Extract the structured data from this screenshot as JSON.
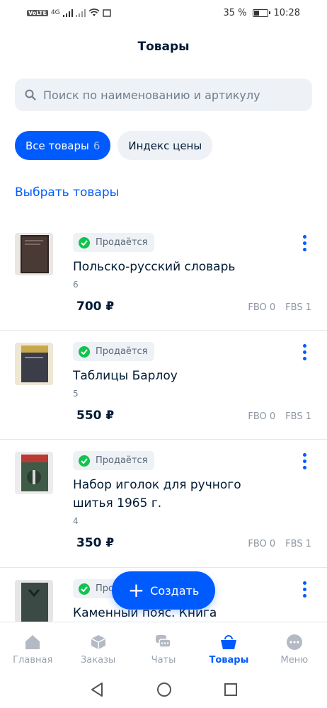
{
  "status_bar": {
    "left_icons": [
      "volte-icon",
      "signal-icon",
      "signal-icon",
      "wifi-icon",
      "notification-icon"
    ],
    "network_label": "4G",
    "battery_percent": "35 %",
    "battery_level": 0.35,
    "time": "10:28"
  },
  "header": {
    "title": "Товары"
  },
  "search": {
    "placeholder": "Поиск по наименованию и артикулу",
    "icon": "search-icon"
  },
  "filters": {
    "all_label": "Все товары",
    "all_count": "6",
    "price_index_label": "Индекс цены"
  },
  "select_link": "Выбрать товары",
  "products": [
    {
      "status": "Продаётся",
      "name": "Польско-русский словарь",
      "sku": "6",
      "price": "700 ₽",
      "fbo": "FBO 0",
      "fbs": "FBS 1"
    },
    {
      "status": "Продаётся",
      "name": "Таблицы Барлоу",
      "sku": "5",
      "price": "550 ₽",
      "fbo": "FBO 0",
      "fbs": "FBS 1"
    },
    {
      "status": "Продаётся",
      "name": "Набор иголок для ручного шитья 1965 г.",
      "sku": "4",
      "price": "350 ₽",
      "fbo": "FBO 0",
      "fbs": "FBS 1"
    },
    {
      "status": "Продаётся",
      "name": "Каменный пояс. Книга",
      "sku": "",
      "price": "",
      "fbo": "",
      "fbs": ""
    }
  ],
  "fab": {
    "label": "Создать",
    "icon": "plus-icon"
  },
  "tabbar": [
    {
      "label": "Главная",
      "icon": "home-icon"
    },
    {
      "label": "Заказы",
      "icon": "box-icon"
    },
    {
      "label": "Чаты",
      "icon": "chat-icon"
    },
    {
      "label": "Товары",
      "icon": "bag-icon",
      "active": true
    },
    {
      "label": "Меню",
      "icon": "menu-dots-icon"
    }
  ],
  "colors": {
    "accent": "#005bff",
    "success": "#10c44c",
    "text": "#001a34",
    "muted": "#707f8d"
  }
}
